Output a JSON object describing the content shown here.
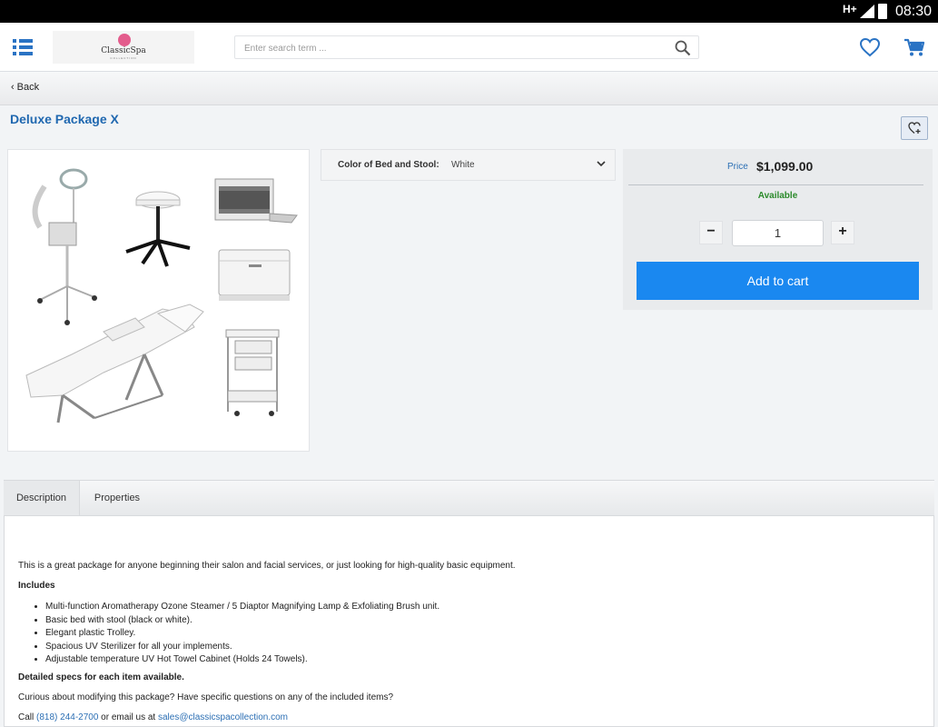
{
  "status_bar": {
    "network": "H+",
    "time": "08:30"
  },
  "header": {
    "logo_name": "ClassicSpa",
    "logo_sub": "COLLECTION",
    "search_placeholder": "Enter search term ..."
  },
  "nav": {
    "back_label": "Back"
  },
  "product": {
    "title": "Deluxe Package X",
    "option_label": "Color of Bed and Stool:",
    "option_value": "White",
    "price_label": "Price",
    "price": "$1,099.00",
    "availability": "Available",
    "quantity": "1",
    "minus_label": "−",
    "plus_label": "+",
    "add_to_cart_label": "Add to cart"
  },
  "tabs": [
    {
      "label": "Description",
      "active": true
    },
    {
      "label": "Properties",
      "active": false
    }
  ],
  "description": {
    "intro": "This is a great package for anyone beginning their salon and facial services, or just looking for high-quality basic equipment.",
    "includes_heading": "Includes",
    "items": [
      "Multi-function Aromatherapy Ozone Steamer / 5 Diaptor Magnifying Lamp & Exfoliating Brush unit.",
      "Basic bed with stool (black or white).",
      "Elegant plastic Trolley.",
      "Spacious UV Sterilizer for all your implements.",
      "Adjustable temperature UV Hot Towel Cabinet (Holds 24 Towels)."
    ],
    "specs_note": "Detailed specs for each item available.",
    "curious_text": "Curious about modifying this package? Have specific questions on any of the included items?",
    "call_prefix": "Call ",
    "phone": "(818) 244-2700",
    "email_prefix": " or email us at ",
    "email": "sales@classicspacollection.com"
  },
  "colors": {
    "accent_blue": "#1a88f0",
    "title_blue": "#2068b0",
    "available_green": "#2b8a2b",
    "logo_pink": "#e35c8c"
  }
}
